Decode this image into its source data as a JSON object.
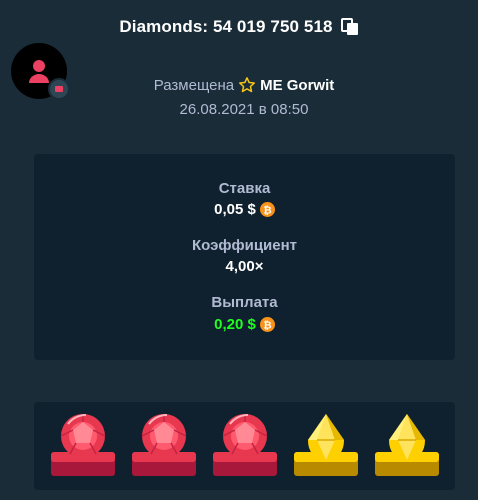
{
  "header": {
    "title": "Diamonds: 54 019 750 518"
  },
  "bet_info": {
    "placed_label": "Размещена",
    "player_name": "ME Gorwit",
    "date": "26.08.2021 в 08:50"
  },
  "stats": {
    "bet_label": "Ставка",
    "bet_value": "0,05 $",
    "multiplier_label": "Коэффициент",
    "multiplier_value": "4,00×",
    "payout_label": "Выплата",
    "payout_value": "0,20 $"
  },
  "tiles": [
    "ruby",
    "ruby",
    "ruby",
    "topaz",
    "topaz"
  ],
  "colors": {
    "background": "#1a2c38",
    "card": "#0f212e",
    "muted_text": "#b1bad3",
    "payout_green": "#1fff20",
    "coin_orange": "#f7931a",
    "ruby": "#e8384f",
    "topaz": "#ffd000",
    "star": "#f5c518"
  }
}
